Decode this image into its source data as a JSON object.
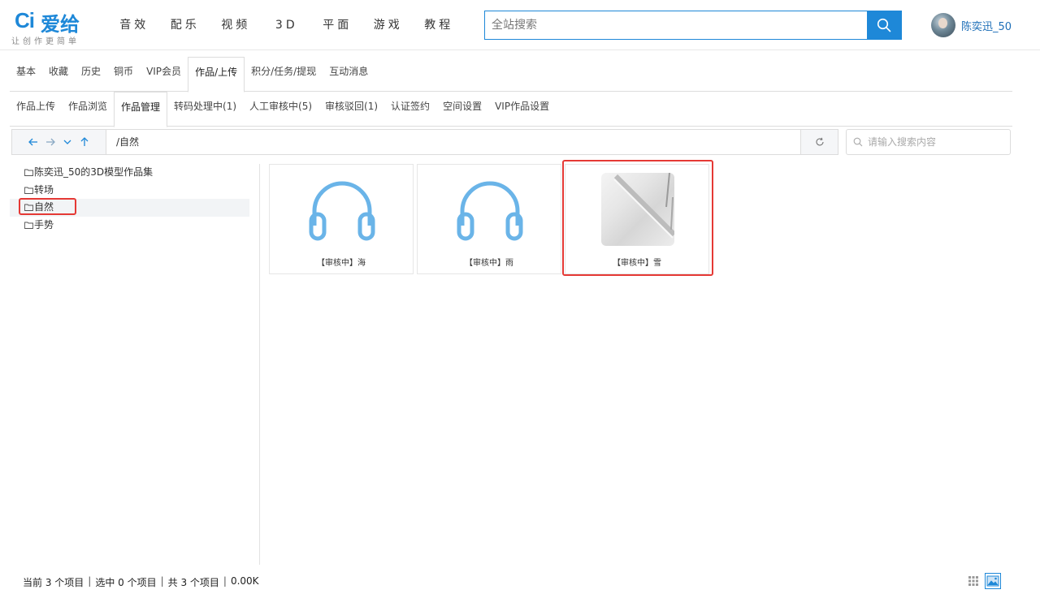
{
  "brand": {
    "mark": "Ci",
    "name": "爱给",
    "slogan": "让创作更简单"
  },
  "nav": [
    "音效",
    "配乐",
    "视频",
    "3D",
    "平面",
    "游戏",
    "教程"
  ],
  "search": {
    "placeholder": "全站搜索"
  },
  "user": {
    "name": "陈奕迅_50"
  },
  "tabs_main": [
    "基本",
    "收藏",
    "历史",
    "铜币",
    "VIP会员",
    "作品/上传",
    "积分/任务/提现",
    "互动消息"
  ],
  "tabs_main_active": "作品/上传",
  "tabs_sub": [
    "作品上传",
    "作品浏览",
    "作品管理",
    "转码处理中(1)",
    "人工审核中(5)",
    "审核驳回(1)",
    "认证签约",
    "空间设置",
    "VIP作品设置"
  ],
  "tabs_sub_active": "作品管理",
  "path": "/自然",
  "file_search": {
    "placeholder": "请输入搜索内容"
  },
  "tree": [
    "陈奕迅_50的3D模型作品集",
    "转场",
    "自然",
    "手势"
  ],
  "tree_selected": "自然",
  "items": [
    {
      "caption": "【审核中】海",
      "type": "audio"
    },
    {
      "caption": "【审核中】雨",
      "type": "audio"
    },
    {
      "caption": "【审核中】雪",
      "type": "image"
    }
  ],
  "status": {
    "current": "当前 3 个项目",
    "selected": "选中 0 个项目",
    "total": "共 3 个项目",
    "size": "0.00K"
  },
  "colors": {
    "accent": "#1e88d8",
    "highlight": "#e53935",
    "headphone": "#6ab4e8"
  }
}
